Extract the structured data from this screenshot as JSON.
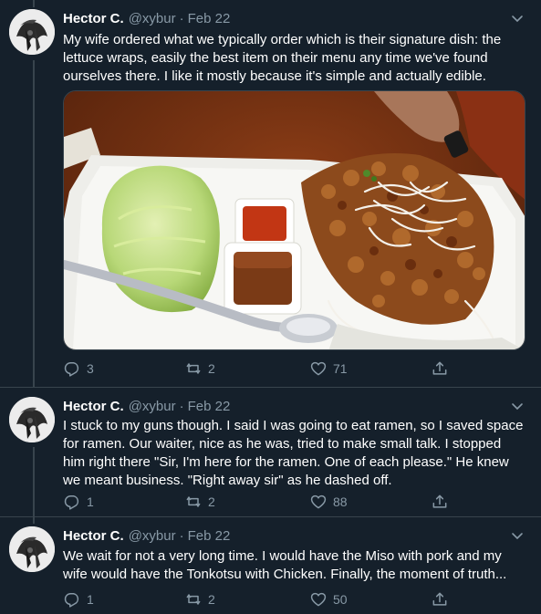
{
  "colors": {
    "background": "#15202b",
    "text": "#ffffff",
    "secondary": "#8899a6",
    "border": "#38444d"
  },
  "tweets": [
    {
      "name": "Hector C.",
      "handle": "@xybur",
      "separator": "·",
      "date": "Feb 22",
      "text": "My wife ordered what we typically order which is their signature dish: the lettuce wraps, easily the best item on their menu any time we've found ourselves there. I like it mostly because it's simple and actually edible.",
      "media": "lettuce-wraps-photo",
      "replies": "3",
      "retweets": "2",
      "likes": "71"
    },
    {
      "name": "Hector C.",
      "handle": "@xybur",
      "separator": "·",
      "date": "Feb 22",
      "text": "I stuck to my guns though. I said I was going to eat ramen, so I saved space for ramen. Our waiter, nice as he was, tried to make small talk. I stopped him right there \"Sir, I'm here for the ramen. One of each please.\" He knew we meant business. \"Right away sir\" as he dashed off.",
      "replies": "1",
      "retweets": "2",
      "likes": "88"
    },
    {
      "name": "Hector C.",
      "handle": "@xybur",
      "separator": "·",
      "date": "Feb 22",
      "text": "We wait for not a very long time. I would have the Miso with pork and my wife would have the Tonkotsu with Chicken. Finally, the moment of truth...",
      "replies": "1",
      "retweets": "2",
      "likes": "50"
    }
  ],
  "icons": {
    "reply": "reply-icon",
    "retweet": "retweet-icon",
    "like": "heart-icon",
    "share": "share-icon",
    "caret": "chevron-down-icon"
  }
}
